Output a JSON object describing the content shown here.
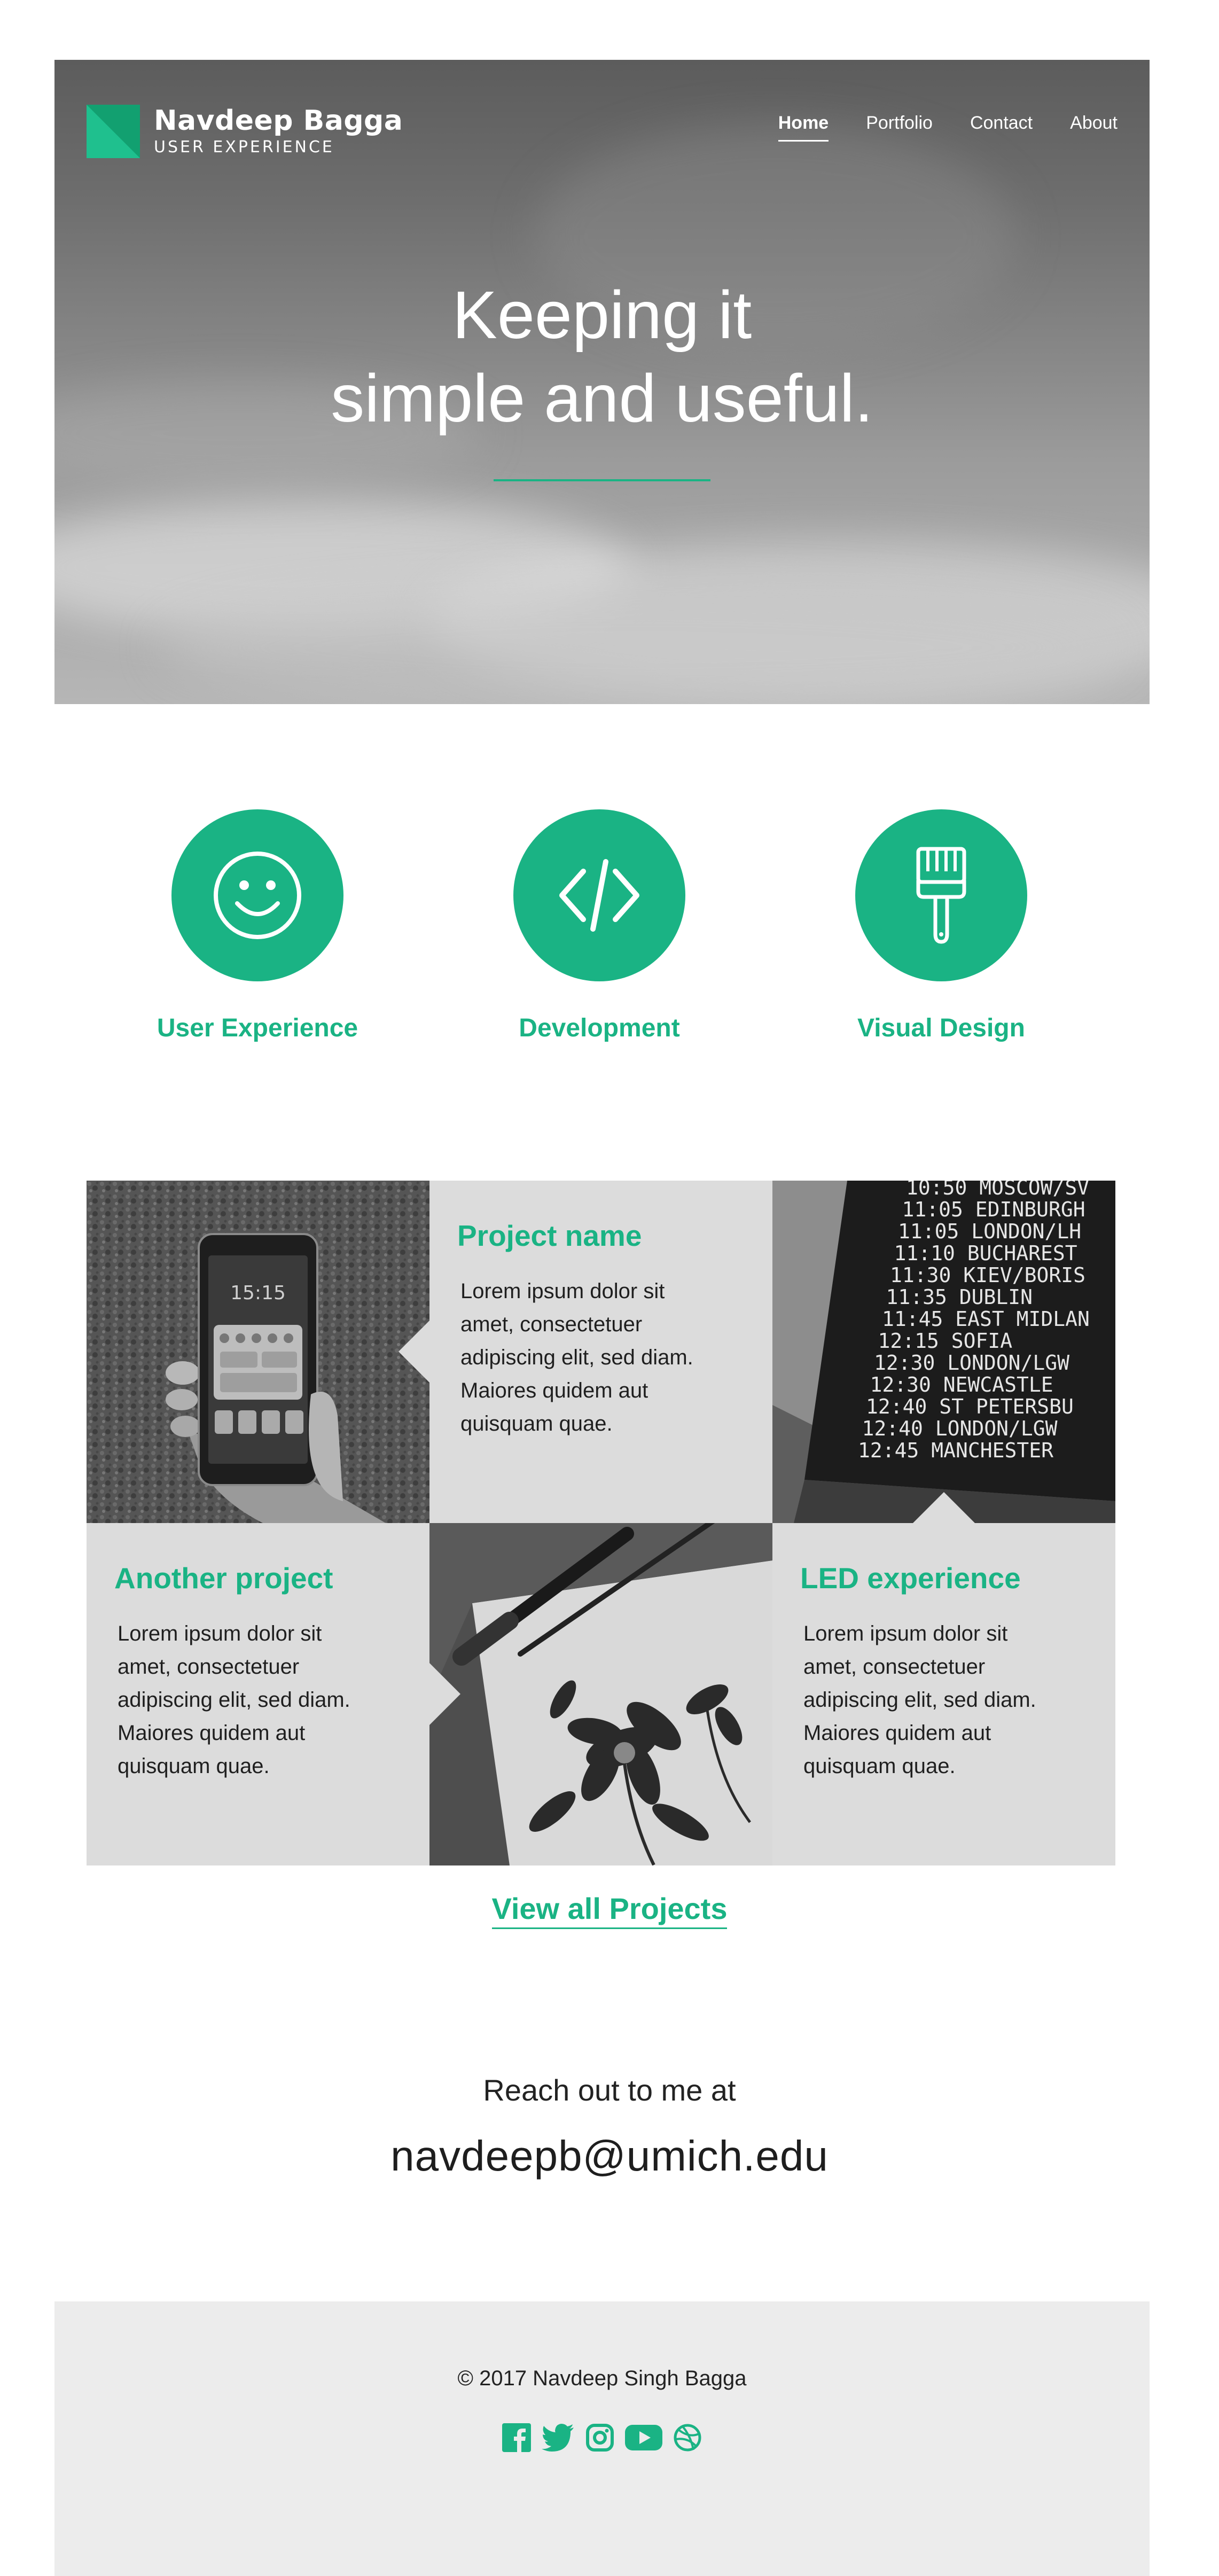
{
  "header": {
    "brand_name": "Navdeep Bagga",
    "brand_tagline": "USER EXPERIENCE",
    "nav": [
      {
        "label": "Home",
        "active": true
      },
      {
        "label": "Portfolio",
        "active": false
      },
      {
        "label": "Contact",
        "active": false
      },
      {
        "label": "About",
        "active": false
      }
    ]
  },
  "hero": {
    "line1": "Keeping it",
    "line2": "simple and useful."
  },
  "services": [
    {
      "title": "User Experience",
      "icon": "smiley-icon"
    },
    {
      "title": "Development",
      "icon": "code-icon"
    },
    {
      "title": "Visual Design",
      "icon": "paintbrush-icon"
    }
  ],
  "projects": [
    {
      "title": "Project name",
      "description": "Lorem ipsum dolor sit amet, consectetuer adipiscing elit, sed diam. Maiores quidem aut quisquam quae.",
      "image": "phone-photo"
    },
    {
      "title": "Another project",
      "description": "Lorem ipsum dolor sit amet, consectetuer adipiscing elit, sed diam. Maiores quidem aut quisquam quae.",
      "image": "flower-drawing-photo"
    },
    {
      "title": "LED experience",
      "description": "Lorem ipsum dolor sit amet, consectetuer adipiscing elit, sed diam. Maiores quidem aut quisquam quae.",
      "image": "departure-board-photo"
    }
  ],
  "departure_board": [
    {
      "time": "10:50",
      "city": "MOSCOW/SV"
    },
    {
      "time": "11:05",
      "city": "EDINBURGH"
    },
    {
      "time": "11:05",
      "city": "LONDON/LH"
    },
    {
      "time": "11:10",
      "city": "BUCHAREST"
    },
    {
      "time": "11:30",
      "city": "KIEV/BORIS"
    },
    {
      "time": "11:35",
      "city": "DUBLIN"
    },
    {
      "time": "11:45",
      "city": "EAST MIDLAN"
    },
    {
      "time": "12:15",
      "city": "SOFIA"
    },
    {
      "time": "12:30",
      "city": "LONDON/LGW"
    },
    {
      "time": "12:30",
      "city": "NEWCASTLE"
    },
    {
      "time": "12:40",
      "city": "ST PETERSBU"
    },
    {
      "time": "12:40",
      "city": "LONDON/LGW"
    },
    {
      "time": "12:45",
      "city": "MANCHESTER"
    }
  ],
  "phone_time": "15:15",
  "view_all_label": "View all Projects",
  "contact": {
    "lead": "Reach out to me at",
    "email": "navdeepb@umich.edu"
  },
  "footer": {
    "copyright": "© 2017 Navdeep Singh Bagga",
    "socials": [
      "facebook-icon",
      "twitter-icon",
      "instagram-icon",
      "youtube-icon",
      "dribbble-icon"
    ]
  },
  "colors": {
    "accent": "#1ab384",
    "tile_gray": "#dcdcdc",
    "footer_bg": "#ececec"
  }
}
